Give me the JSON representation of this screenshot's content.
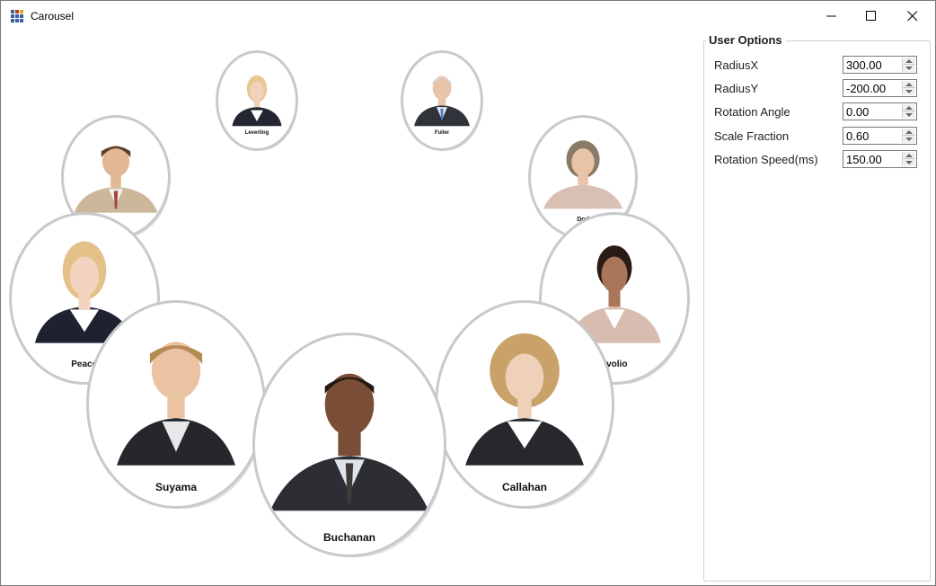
{
  "window": {
    "title": "Carousel",
    "controls": [
      "minimize-icon",
      "maximize-icon",
      "close-icon"
    ]
  },
  "carousel": {
    "items": [
      {
        "name": "Leverling"
      },
      {
        "name": "Fuller"
      },
      {
        "name": ""
      },
      {
        "name": "Dod"
      },
      {
        "name": "Peaco"
      },
      {
        "name": "avolio"
      },
      {
        "name": "Suyama"
      },
      {
        "name": "Callahan"
      },
      {
        "name": "Buchanan"
      }
    ]
  },
  "options": {
    "title": "User Options",
    "fields": [
      {
        "label": "RadiusX",
        "value": "300.00"
      },
      {
        "label": "RadiusY",
        "value": "-200.00"
      },
      {
        "label": "Rotation Angle",
        "value": "0.00"
      },
      {
        "label": "Scale Fraction",
        "value": "0.60"
      },
      {
        "label": "Rotation Speed(ms)",
        "value": "150.00"
      }
    ]
  },
  "colors": {
    "accent": "#4a7cc9",
    "suit_dark": "#2b2d33",
    "suit_light": "#c8b59a",
    "suit_beige": "#d9c0b4"
  }
}
